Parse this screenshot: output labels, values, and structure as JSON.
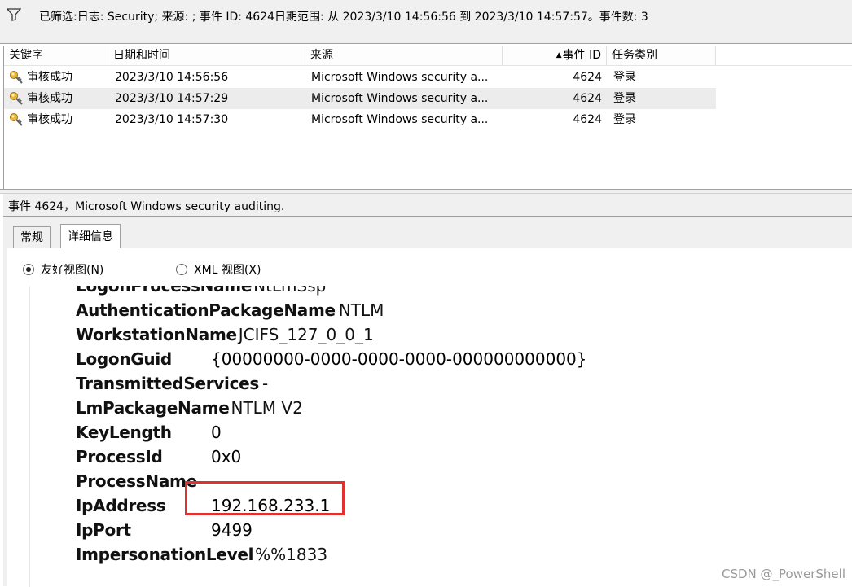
{
  "filter_bar": {
    "text": "已筛选:日志: Security; 来源: ; 事件 ID: 4624日期范围: 从 2023/3/10 14:56:56 到 2023/3/10 14:57:57。事件数: 3"
  },
  "event_list": {
    "columns": [
      "关键字",
      "日期和时间",
      "来源",
      "事件 ID",
      "任务类别"
    ],
    "rows": [
      {
        "keyword": "审核成功",
        "datetime": "2023/3/10 14:56:56",
        "source": "Microsoft Windows security a...",
        "event_id": "4624",
        "task": "登录"
      },
      {
        "keyword": "审核成功",
        "datetime": "2023/3/10 14:57:29",
        "source": "Microsoft Windows security a...",
        "event_id": "4624",
        "task": "登录"
      },
      {
        "keyword": "审核成功",
        "datetime": "2023/3/10 14:57:30",
        "source": "Microsoft Windows security a...",
        "event_id": "4624",
        "task": "登录"
      }
    ],
    "sorted_column": "事件 ID"
  },
  "event_header": {
    "text": "事件 4624，Microsoft Windows security auditing."
  },
  "tabs": [
    {
      "label": "常规",
      "active": false
    },
    {
      "label": "详细信息",
      "active": true
    }
  ],
  "view_options": [
    {
      "label": "友好视图(N)",
      "checked": true
    },
    {
      "label": "XML 视图(X)",
      "checked": false
    }
  ],
  "details": {
    "fields": [
      {
        "name": "LogonProcessName",
        "value": "NtLmSsp"
      },
      {
        "name": "AuthenticationPackageName",
        "value": "NTLM"
      },
      {
        "name": "WorkstationName",
        "value": "JCIFS_127_0_0_1"
      },
      {
        "name": "LogonGuid",
        "value": "{00000000-0000-0000-0000-000000000000}"
      },
      {
        "name": "TransmittedServices",
        "value": "-"
      },
      {
        "name": "LmPackageName",
        "value": "NTLM V2"
      },
      {
        "name": "KeyLength",
        "value": "0"
      },
      {
        "name": "ProcessId",
        "value": "0x0"
      },
      {
        "name": "ProcessName",
        "value": "-"
      },
      {
        "name": "IpAddress",
        "value": "192.168.233.1"
      },
      {
        "name": "IpPort",
        "value": "9499"
      },
      {
        "name": "ImpersonationLevel",
        "value": "%%1833"
      }
    ],
    "highlight_color": "#e03030"
  },
  "watermark": "CSDN @_PowerShell",
  "icons": {
    "filter": "filter-icon",
    "key": "key-icon"
  }
}
